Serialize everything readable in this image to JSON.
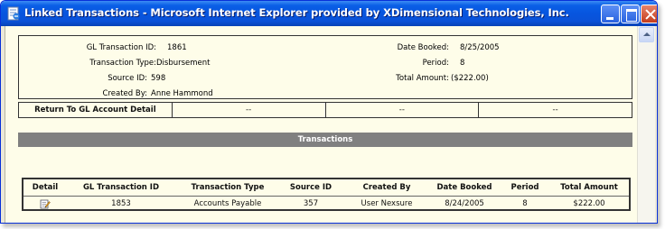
{
  "window": {
    "title": "Linked Transactions - Microsoft Internet Explorer provided by XDimensional Technologies, Inc."
  },
  "details": {
    "gl_transaction_id_label": "GL Transaction ID:",
    "gl_transaction_id": "1861",
    "transaction_type_label": "Transaction Type:",
    "transaction_type": "Disbursement",
    "source_id_label": "Source ID:",
    "source_id": "598",
    "created_by_label": "Created By:",
    "created_by": "Anne Hammond",
    "date_booked_label": "Date Booked:",
    "date_booked": "8/25/2005",
    "period_label": "Period:",
    "period": "8",
    "total_amount_label": "Total Amount:",
    "total_amount": "($222.00)"
  },
  "nav": {
    "return_label": "Return To GL Account Detail",
    "cells": [
      "--",
      "--",
      "--"
    ]
  },
  "transactions": {
    "section_title": "Transactions",
    "columns": [
      "Detail",
      "GL Transaction ID",
      "Transaction Type",
      "Source ID",
      "Created By",
      "Date Booked",
      "Period",
      "Total Amount"
    ],
    "rows": [
      {
        "detail_icon": "edit-icon",
        "gl_transaction_id": "1853",
        "transaction_type": "Accounts Payable",
        "source_id": "357",
        "created_by": "User Nexsure",
        "date_booked": "8/24/2005",
        "period": "8",
        "total_amount": "$222.00"
      }
    ]
  },
  "colors": {
    "titlebar": "#0755df",
    "content_bg": "#fefde9",
    "section_header": "#808080"
  }
}
